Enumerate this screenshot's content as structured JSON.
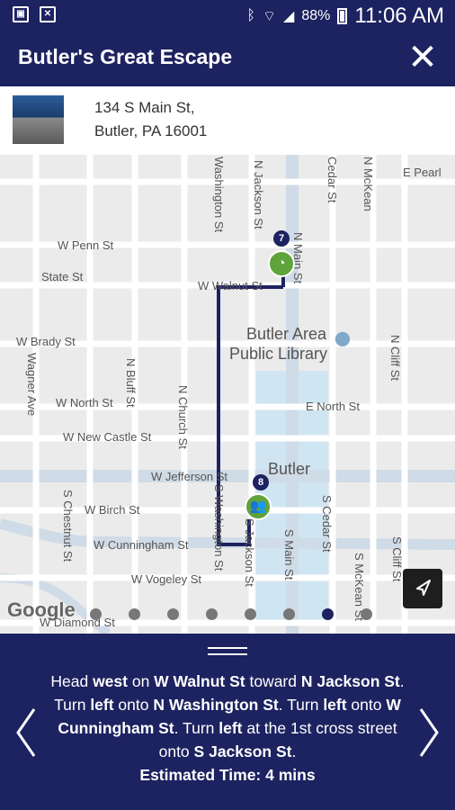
{
  "status_bar": {
    "battery": "88%",
    "time": "11:06 AM",
    "icons": [
      "image-icon",
      "file-icon",
      "bluetooth-icon",
      "wifi-icon",
      "signal-icon",
      "battery-icon"
    ]
  },
  "header": {
    "title": "Butler's Great Escape",
    "close_icon": "close-icon"
  },
  "address": {
    "line1": "134 S Main St,",
    "line2": "Butler, PA 16001"
  },
  "map": {
    "streets": {
      "e_pearl": "E Pearl",
      "w_penn": "W Penn St",
      "state": "State St",
      "w_walnut": "W Walnut St",
      "w_brady": "W Brady St",
      "w_north": "W North St",
      "e_north": "E North St",
      "w_new_castle": "W New Castle St",
      "w_jefferson": "W Jefferson St",
      "w_birch": "W Birch St",
      "w_cunningham": "W Cunningham St",
      "w_vogeley": "W Vogeley St",
      "w_diamond": "W Diamond St",
      "washington": "Washington St",
      "n_jackson": "N Jackson St",
      "n_main": "N Main St",
      "cedar": "Cedar St",
      "n_mckean": "N McKean",
      "wagner": "Wagner Ave",
      "n_bluff": "N Bluff St",
      "n_church": "N Church St",
      "s_chestnut": "S Chestnut St",
      "s_washington": "S Washington St",
      "s_jackson": "S Jackson St",
      "s_main": "S Main St",
      "s_cedar": "S Cedar St",
      "s_mckean": "S McKean St",
      "n_cliff": "N Cliff St",
      "s_cliff": "S Cliff St"
    },
    "places": {
      "library_line1": "Butler Area",
      "library_line2": "Public Library",
      "butler": "Butler"
    },
    "markers": [
      {
        "number": "7",
        "icon": "food-icon"
      },
      {
        "number": "8",
        "icon": "restroom-icon"
      }
    ],
    "google_logo": "Google",
    "locate_icon": "navigation-arrow-icon",
    "pagination": {
      "count": 8,
      "active_index": 6
    },
    "colors": {
      "route": "#1d2260",
      "poi": "#5fa33b",
      "water": "#c9e3f4"
    }
  },
  "directions": {
    "handle_icon": "drag-handle-icon",
    "prev_icon": "chevron-left-icon",
    "next_icon": "chevron-right-icon",
    "seg": {
      "s1": "Head ",
      "b1": "west",
      "s2": " on ",
      "b2": "W Walnut St",
      "s3": " toward ",
      "b3": "N Jackson St",
      "s4": ". Turn ",
      "b4": "left",
      "s5": " onto ",
      "b5": "N Washington St",
      "s6": ". Turn ",
      "b6": "left",
      "s7": " onto ",
      "b7": "W Cunningham St",
      "s8": ". Turn ",
      "b8": "left",
      "s9": " at the 1st cross street onto ",
      "b9": "S Jackson St",
      "s10": "."
    },
    "estimated_time": "Estimated Time: 4 mins"
  }
}
